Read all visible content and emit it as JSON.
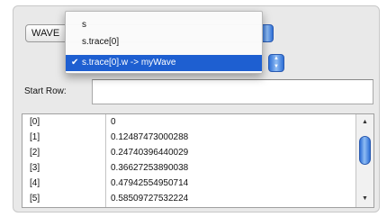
{
  "wave_popup": {
    "selected_value": "WAVE",
    "options": [
      {
        "label": "s",
        "checked": false
      },
      {
        "label": "s.trace[0]",
        "checked": false
      },
      {
        "label": "s.trace[0].w -> myWave",
        "checked": true
      }
    ],
    "check_glyph": "✔"
  },
  "start_row": {
    "label": "Start Row:",
    "value": ""
  },
  "table": {
    "rows": [
      {
        "index": "[0]",
        "value": "0"
      },
      {
        "index": "[1]",
        "value": "0.12487473000288"
      },
      {
        "index": "[2]",
        "value": "0.24740396440029"
      },
      {
        "index": "[3]",
        "value": "0.36627253890038"
      },
      {
        "index": "[4]",
        "value": "0.47942554950714"
      },
      {
        "index": "[5]",
        "value": "0.58509727532224"
      }
    ]
  },
  "colors": {
    "accent": "#1e5fd1",
    "panel": "#e9e9e9"
  }
}
